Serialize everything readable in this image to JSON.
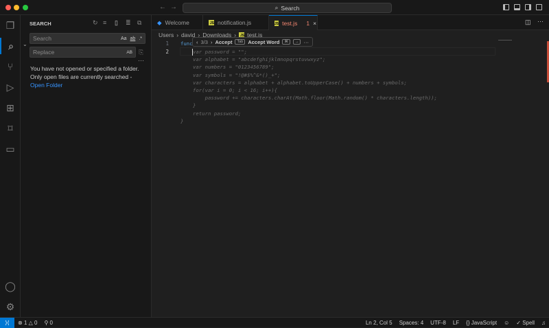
{
  "titlebar": {
    "search": "Search"
  },
  "sidebar": {
    "title": "SEARCH",
    "search_placeholder": "Search",
    "replace_placeholder": "Replace",
    "match_case": "Aa",
    "whole_word": "ab",
    "regex": ".*",
    "preserve_case": "AB",
    "more": "···",
    "message1": "You have not opened or specified a folder.",
    "message2": "Only open files are currently searched -",
    "open_folder": "Open Folder"
  },
  "tabs": [
    {
      "label": "Welcome"
    },
    {
      "label": "notification.js"
    },
    {
      "label": "test.js",
      "problems": "1",
      "close": "×"
    }
  ],
  "breadcrumb": [
    "Users",
    "david",
    "Downloads",
    "test.js"
  ],
  "editor": {
    "line_numbers": [
      "1",
      "2"
    ],
    "line1": "func",
    "lines": [
      "var password = \"\";",
      "var alphabet = \"abcdefghijklmnopqrstuvwxyz\";",
      "var numbers = \"0123456789\";",
      "var symbols = \"!@#$%^&*()_+\";",
      "var characters = alphabet + alphabet.toUpperCase() + numbers + symbols;",
      "for(var i = 0; i < 16; i++){",
      "    password += characters.charAt(Math.floor(Math.random() * characters.length));",
      "}",
      "return password;"
    ],
    "closing": "}"
  },
  "suggest": {
    "prev": "‹",
    "count": "3/3",
    "next": "›",
    "accept": "Accept",
    "accept_key": "Tab",
    "accept_word": "Accept Word",
    "key1": "⌘",
    "key2": "→",
    "more": "···"
  },
  "statusbar": {
    "errors": "1",
    "warnings": "0",
    "ports": "0",
    "position": "Ln 2, Col 5",
    "spaces": "Spaces: 4",
    "encoding": "UTF-8",
    "eol": "LF",
    "language": "JavaScript",
    "spell": "Spell"
  }
}
